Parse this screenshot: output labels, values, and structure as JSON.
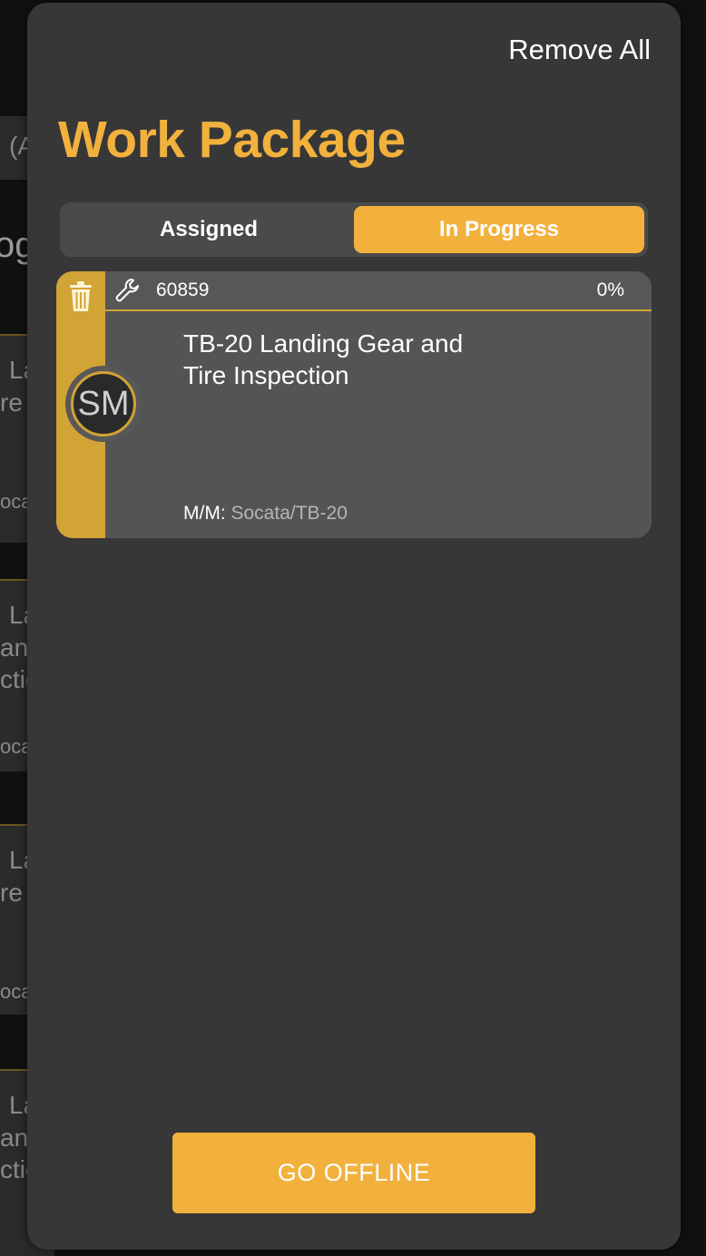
{
  "colors": {
    "accent": "#f2b13d",
    "card_accent": "#d2a335",
    "panel_bg": "#373737",
    "card_bg": "#545454"
  },
  "background": {
    "lines": [
      "(A",
      "og",
      "La",
      "re",
      "oca",
      "La",
      "anc",
      "ctic",
      "oca",
      "La",
      "re",
      "oca",
      "La",
      "anc",
      "ctic"
    ]
  },
  "header": {
    "remove_all_label": "Remove All",
    "title": "Work Package"
  },
  "tabs": [
    {
      "label": "Assigned",
      "active": false
    },
    {
      "label": "In Progress",
      "active": true
    }
  ],
  "work_items": [
    {
      "number": "60859",
      "progress": "0%",
      "title": "TB-20 Landing Gear and Tire Inspection",
      "assignee_initials": "SM",
      "mm_label": "M/M:",
      "mm_value": "Socata/TB-20",
      "icons": [
        "trash-icon",
        "wrench-icon"
      ]
    }
  ],
  "footer": {
    "go_offline_label": "GO OFFLINE"
  }
}
